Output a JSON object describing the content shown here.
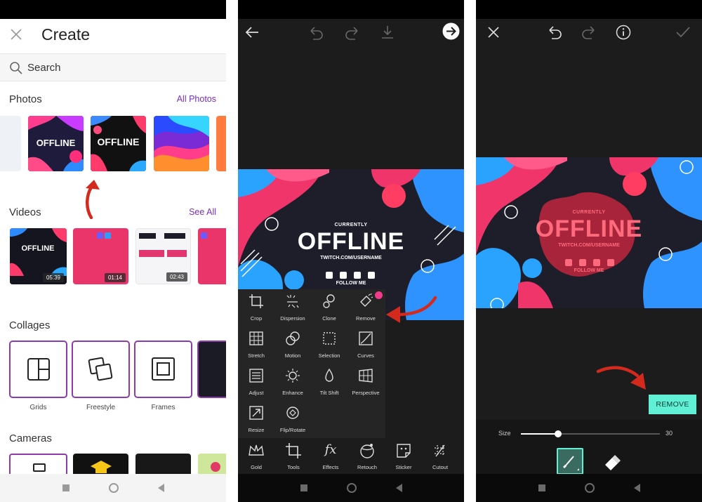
{
  "colors": {
    "accent_purple": "#7a2fc2",
    "remove_button": "#5ff0d6",
    "red_arrow": "#d42a1e"
  },
  "create": {
    "title": "Create",
    "search_label": "Search",
    "photos": {
      "title": "Photos",
      "link": "All Photos",
      "thumbs": [
        {
          "headline": "OFFLINE"
        },
        {
          "headline": "OFFLINE"
        }
      ]
    },
    "videos": {
      "title": "Videos",
      "link": "See All",
      "durations": [
        "05:39",
        "01:14",
        "02:43"
      ]
    },
    "collages": {
      "title": "Collages",
      "items": [
        "Grids",
        "Freestyle",
        "Frames"
      ]
    },
    "cameras": {
      "title": "Cameras"
    }
  },
  "banner": {
    "currently": "CURRENTLY",
    "offline": "OFFLINE",
    "url": "TWITCH.COM/USERNAME",
    "follow": "FOLLOW ME"
  },
  "tools": [
    {
      "label": "Crop",
      "icon": "crop-icon"
    },
    {
      "label": "Dispersion",
      "icon": "dispersion-icon"
    },
    {
      "label": "Clone",
      "icon": "clone-icon"
    },
    {
      "label": "Remove",
      "icon": "remove-icon"
    },
    {
      "label": "Stretch",
      "icon": "stretch-icon"
    },
    {
      "label": "Motion",
      "icon": "motion-icon"
    },
    {
      "label": "Selection",
      "icon": "selection-icon"
    },
    {
      "label": "Curves",
      "icon": "curves-icon"
    },
    {
      "label": "Adjust",
      "icon": "adjust-icon"
    },
    {
      "label": "Enhance",
      "icon": "enhance-icon"
    },
    {
      "label": "Tilt Shift",
      "icon": "tilt-shift-icon"
    },
    {
      "label": "Perspective",
      "icon": "perspective-icon"
    },
    {
      "label": "Resize",
      "icon": "resize-icon"
    },
    {
      "label": "Flip/Rotate",
      "icon": "flip-rotate-icon"
    }
  ],
  "bottom_toolbar": [
    {
      "label": "Gold",
      "icon": "crown-icon"
    },
    {
      "label": "Tools",
      "icon": "crop-icon"
    },
    {
      "label": "Effects",
      "icon": "fx-icon"
    },
    {
      "label": "Retouch",
      "icon": "retouch-icon"
    },
    {
      "label": "Sticker",
      "icon": "sticker-icon"
    },
    {
      "label": "Cutout",
      "icon": "cutout-icon"
    }
  ],
  "remove_screen": {
    "button_label": "REMOVE",
    "size_label": "Size",
    "size_value": "30",
    "size_fraction": 0.27
  }
}
